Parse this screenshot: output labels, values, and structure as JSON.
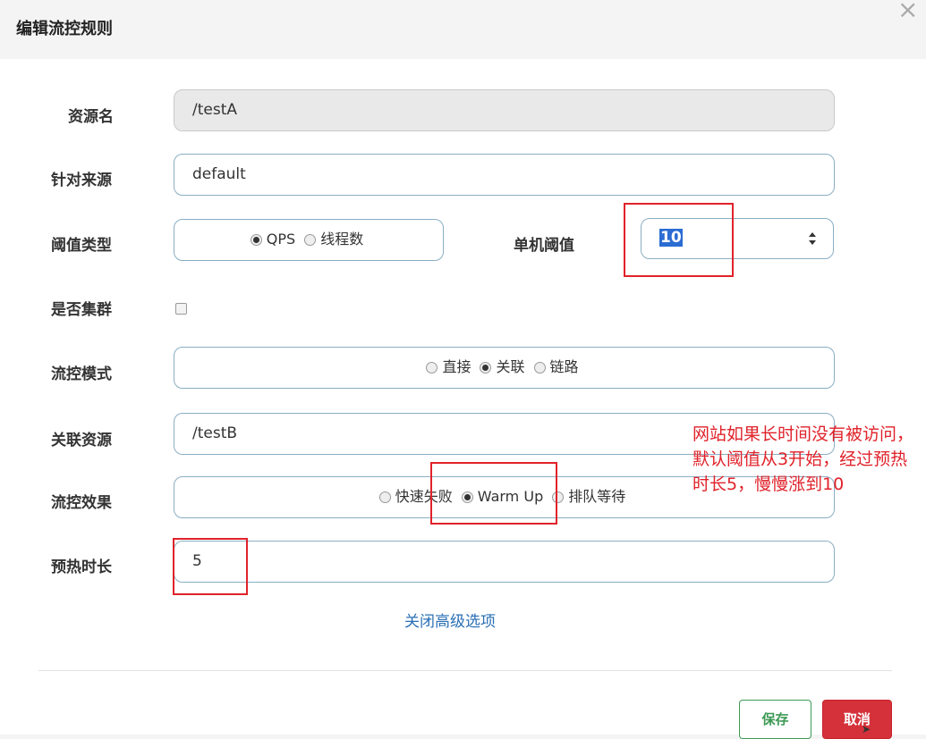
{
  "dialog": {
    "title": "编辑流控规则",
    "close_icon": "close-icon"
  },
  "form": {
    "resource_name": {
      "label": "资源名",
      "value": "/testA"
    },
    "limit_app": {
      "label": "针对来源",
      "value": "default"
    },
    "threshold_type": {
      "label": "阈值类型",
      "options": [
        "QPS",
        "线程数"
      ],
      "selected": "QPS"
    },
    "single_threshold": {
      "label": "单机阈值",
      "value": "10"
    },
    "cluster": {
      "label": "是否集群",
      "checked": false
    },
    "control_mode": {
      "label": "流控模式",
      "options": [
        "直接",
        "关联",
        "链路"
      ],
      "selected": "关联"
    },
    "ref_resource": {
      "label": "关联资源",
      "value": "/testB"
    },
    "control_effect": {
      "label": "流控效果",
      "options": [
        "快速失败",
        "Warm Up",
        "排队等待"
      ],
      "selected": "Warm Up"
    },
    "warmup_period": {
      "label": "预热时长",
      "value": "5"
    },
    "advanced_link": "关闭高级选项"
  },
  "footer": {
    "save_label": "保存",
    "cancel_label": "取消"
  },
  "annotation": {
    "text": "网站如果长时间没有被访问，默认阈值从3开始，经过预热时长5，慢慢涨到10",
    "color": "#e0222a"
  },
  "colors": {
    "field_border": "#8aaec4",
    "link": "#2a6fb5",
    "save": "#3d9a55",
    "cancel": "#d4313a",
    "highlight": "#e0222a"
  }
}
